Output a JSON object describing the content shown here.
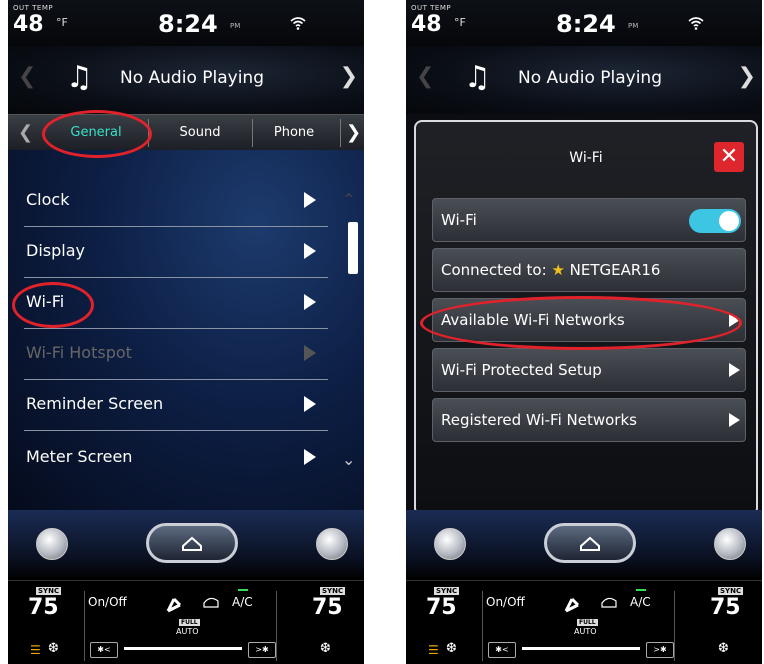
{
  "left_screen": {
    "status": {
      "out_temp_label": "OUT TEMP",
      "out_temp": "48",
      "unit": "°F",
      "time": "8:24",
      "ampm": "PM"
    },
    "audio": {
      "title": "No Audio Playing"
    },
    "tabs": {
      "general": "General",
      "sound": "Sound",
      "phone": "Phone"
    },
    "menu": [
      {
        "label": "Clock",
        "enabled": true
      },
      {
        "label": "Display",
        "enabled": true
      },
      {
        "label": "Wi-Fi",
        "enabled": true
      },
      {
        "label": "Wi-Fi Hotspot",
        "enabled": false
      },
      {
        "label": "Reminder Screen",
        "enabled": true
      },
      {
        "label": "Meter Screen",
        "enabled": true
      }
    ],
    "climate": {
      "sync": "SYNC",
      "left_temp": "75",
      "right_temp": "75",
      "on_off": "On/Off",
      "ac": "A/C",
      "full": "FULL",
      "auto": "AUTO"
    }
  },
  "right_screen": {
    "status": {
      "out_temp_label": "OUT TEMP",
      "out_temp": "48",
      "unit": "°F",
      "time": "8:24",
      "ampm": "PM"
    },
    "audio": {
      "title": "No Audio Playing"
    },
    "dialog": {
      "title": "Wi-Fi",
      "close": "✕",
      "wifi_label": "Wi-Fi",
      "wifi_on": true,
      "connected_prefix": "Connected to:",
      "connected_network": "NETGEAR16",
      "available": "Available Wi-Fi Networks",
      "protected": "Wi-Fi Protected Setup",
      "registered": "Registered Wi-Fi Networks"
    },
    "climate": {
      "sync": "SYNC",
      "left_temp": "75",
      "right_temp": "75",
      "on_off": "On/Off",
      "ac": "A/C",
      "full": "FULL",
      "auto": "AUTO"
    }
  },
  "colors": {
    "annotation": "#e2222a",
    "toggle": "#3cc6e4",
    "close": "#e0262d",
    "star": "#f3c01a"
  }
}
